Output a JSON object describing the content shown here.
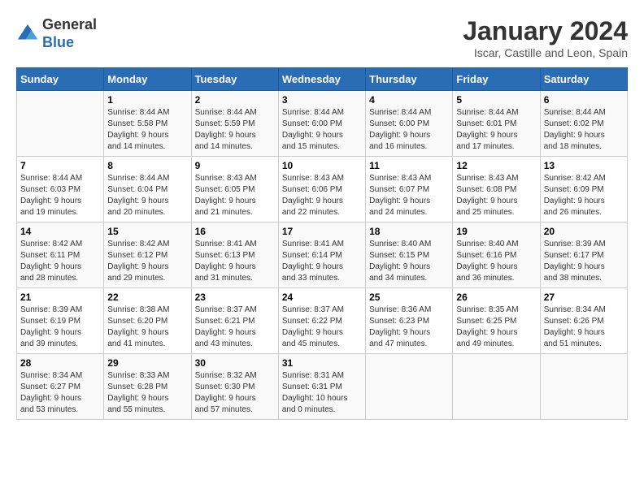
{
  "logo": {
    "general": "General",
    "blue": "Blue"
  },
  "title": "January 2024",
  "subtitle": "Iscar, Castille and Leon, Spain",
  "days_header": [
    "Sunday",
    "Monday",
    "Tuesday",
    "Wednesday",
    "Thursday",
    "Friday",
    "Saturday"
  ],
  "weeks": [
    [
      {
        "day": "",
        "info": ""
      },
      {
        "day": "1",
        "info": "Sunrise: 8:44 AM\nSunset: 5:58 PM\nDaylight: 9 hours\nand 14 minutes."
      },
      {
        "day": "2",
        "info": "Sunrise: 8:44 AM\nSunset: 5:59 PM\nDaylight: 9 hours\nand 14 minutes."
      },
      {
        "day": "3",
        "info": "Sunrise: 8:44 AM\nSunset: 6:00 PM\nDaylight: 9 hours\nand 15 minutes."
      },
      {
        "day": "4",
        "info": "Sunrise: 8:44 AM\nSunset: 6:00 PM\nDaylight: 9 hours\nand 16 minutes."
      },
      {
        "day": "5",
        "info": "Sunrise: 8:44 AM\nSunset: 6:01 PM\nDaylight: 9 hours\nand 17 minutes."
      },
      {
        "day": "6",
        "info": "Sunrise: 8:44 AM\nSunset: 6:02 PM\nDaylight: 9 hours\nand 18 minutes."
      }
    ],
    [
      {
        "day": "7",
        "info": "Sunrise: 8:44 AM\nSunset: 6:03 PM\nDaylight: 9 hours\nand 19 minutes."
      },
      {
        "day": "8",
        "info": "Sunrise: 8:44 AM\nSunset: 6:04 PM\nDaylight: 9 hours\nand 20 minutes."
      },
      {
        "day": "9",
        "info": "Sunrise: 8:43 AM\nSunset: 6:05 PM\nDaylight: 9 hours\nand 21 minutes."
      },
      {
        "day": "10",
        "info": "Sunrise: 8:43 AM\nSunset: 6:06 PM\nDaylight: 9 hours\nand 22 minutes."
      },
      {
        "day": "11",
        "info": "Sunrise: 8:43 AM\nSunset: 6:07 PM\nDaylight: 9 hours\nand 24 minutes."
      },
      {
        "day": "12",
        "info": "Sunrise: 8:43 AM\nSunset: 6:08 PM\nDaylight: 9 hours\nand 25 minutes."
      },
      {
        "day": "13",
        "info": "Sunrise: 8:42 AM\nSunset: 6:09 PM\nDaylight: 9 hours\nand 26 minutes."
      }
    ],
    [
      {
        "day": "14",
        "info": "Sunrise: 8:42 AM\nSunset: 6:11 PM\nDaylight: 9 hours\nand 28 minutes."
      },
      {
        "day": "15",
        "info": "Sunrise: 8:42 AM\nSunset: 6:12 PM\nDaylight: 9 hours\nand 29 minutes."
      },
      {
        "day": "16",
        "info": "Sunrise: 8:41 AM\nSunset: 6:13 PM\nDaylight: 9 hours\nand 31 minutes."
      },
      {
        "day": "17",
        "info": "Sunrise: 8:41 AM\nSunset: 6:14 PM\nDaylight: 9 hours\nand 33 minutes."
      },
      {
        "day": "18",
        "info": "Sunrise: 8:40 AM\nSunset: 6:15 PM\nDaylight: 9 hours\nand 34 minutes."
      },
      {
        "day": "19",
        "info": "Sunrise: 8:40 AM\nSunset: 6:16 PM\nDaylight: 9 hours\nand 36 minutes."
      },
      {
        "day": "20",
        "info": "Sunrise: 8:39 AM\nSunset: 6:17 PM\nDaylight: 9 hours\nand 38 minutes."
      }
    ],
    [
      {
        "day": "21",
        "info": "Sunrise: 8:39 AM\nSunset: 6:19 PM\nDaylight: 9 hours\nand 39 minutes."
      },
      {
        "day": "22",
        "info": "Sunrise: 8:38 AM\nSunset: 6:20 PM\nDaylight: 9 hours\nand 41 minutes."
      },
      {
        "day": "23",
        "info": "Sunrise: 8:37 AM\nSunset: 6:21 PM\nDaylight: 9 hours\nand 43 minutes."
      },
      {
        "day": "24",
        "info": "Sunrise: 8:37 AM\nSunset: 6:22 PM\nDaylight: 9 hours\nand 45 minutes."
      },
      {
        "day": "25",
        "info": "Sunrise: 8:36 AM\nSunset: 6:23 PM\nDaylight: 9 hours\nand 47 minutes."
      },
      {
        "day": "26",
        "info": "Sunrise: 8:35 AM\nSunset: 6:25 PM\nDaylight: 9 hours\nand 49 minutes."
      },
      {
        "day": "27",
        "info": "Sunrise: 8:34 AM\nSunset: 6:26 PM\nDaylight: 9 hours\nand 51 minutes."
      }
    ],
    [
      {
        "day": "28",
        "info": "Sunrise: 8:34 AM\nSunset: 6:27 PM\nDaylight: 9 hours\nand 53 minutes."
      },
      {
        "day": "29",
        "info": "Sunrise: 8:33 AM\nSunset: 6:28 PM\nDaylight: 9 hours\nand 55 minutes."
      },
      {
        "day": "30",
        "info": "Sunrise: 8:32 AM\nSunset: 6:30 PM\nDaylight: 9 hours\nand 57 minutes."
      },
      {
        "day": "31",
        "info": "Sunrise: 8:31 AM\nSunset: 6:31 PM\nDaylight: 10 hours\nand 0 minutes."
      },
      {
        "day": "",
        "info": ""
      },
      {
        "day": "",
        "info": ""
      },
      {
        "day": "",
        "info": ""
      }
    ]
  ]
}
